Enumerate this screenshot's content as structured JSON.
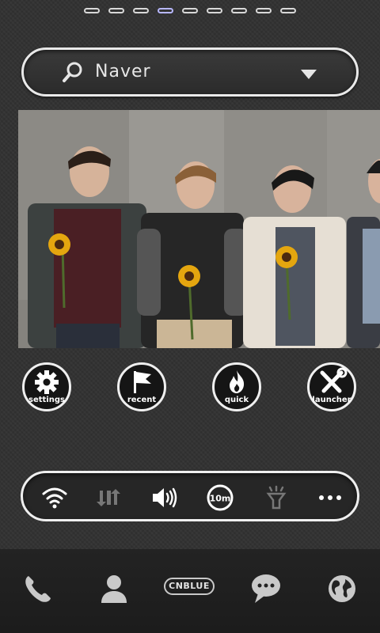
{
  "pager": {
    "count": 9,
    "active_index": 3
  },
  "search": {
    "text": "Naver"
  },
  "shortcuts": [
    {
      "label": "settings",
      "icon": "gear-icon"
    },
    {
      "label": "recent",
      "icon": "flag-icon"
    },
    {
      "label": "quick",
      "icon": "flame-icon"
    },
    {
      "label": "launcher",
      "icon": "tools-icon"
    }
  ],
  "toggles": [
    {
      "name": "wifi-toggle",
      "icon": "wifi-icon"
    },
    {
      "name": "mobile-data-toggle",
      "icon": "data-arrows-icon"
    },
    {
      "name": "volume-toggle",
      "icon": "speaker-icon"
    },
    {
      "name": "screen-timeout-toggle",
      "icon": "timer-icon",
      "text": "10m"
    },
    {
      "name": "flashlight-toggle",
      "icon": "flashlight-icon"
    },
    {
      "name": "more-toggle",
      "icon": "more-icon"
    }
  ],
  "dock": {
    "items": [
      {
        "name": "phone",
        "icon": "phone-icon"
      },
      {
        "name": "contacts",
        "icon": "contact-icon"
      },
      {
        "name": "cnblue",
        "text": "CNBLUE"
      },
      {
        "name": "messages",
        "icon": "chat-icon"
      },
      {
        "name": "browser",
        "icon": "globe-icon"
      }
    ]
  },
  "colors": {
    "pager_active": "#b7b7ff",
    "frame": "#efefef",
    "background": "#2f2f2f"
  }
}
